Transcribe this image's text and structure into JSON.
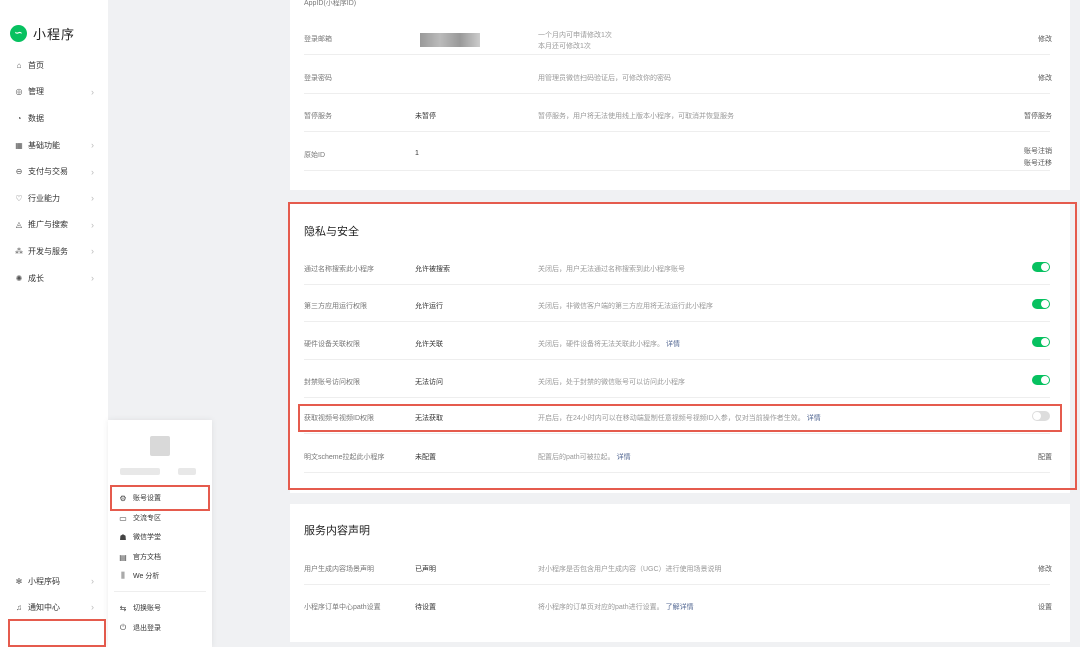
{
  "sidebar": {
    "brand": "小程序",
    "items": [
      {
        "icon": "home-icon",
        "glyph": "⌂",
        "label": "首页",
        "has_children": false
      },
      {
        "icon": "manage-icon",
        "glyph": "◎",
        "label": "管理",
        "has_children": true
      },
      {
        "icon": "data-icon",
        "glyph": "◔",
        "label": "数据",
        "has_children": false
      },
      {
        "icon": "basic-function-icon",
        "glyph": "▦",
        "label": "基础功能",
        "has_children": true
      },
      {
        "icon": "payment-icon",
        "glyph": "⊖",
        "label": "支付与交易",
        "has_children": true
      },
      {
        "icon": "industry-icon",
        "glyph": "♡",
        "label": "行业能力",
        "has_children": true
      },
      {
        "icon": "promotion-icon",
        "glyph": "◬",
        "label": "推广与搜索",
        "has_children": true
      },
      {
        "icon": "dev-service-icon",
        "glyph": "⁂",
        "label": "开发与服务",
        "has_children": true
      },
      {
        "icon": "growth-icon",
        "glyph": "✺",
        "label": "成长",
        "has_children": true
      }
    ],
    "footer": [
      {
        "icon": "miniprogram-code-icon",
        "glyph": "✻",
        "label": "小程序码"
      },
      {
        "icon": "bell-icon",
        "glyph": "♫",
        "label": "通知中心"
      }
    ]
  },
  "popup": {
    "items": [
      {
        "icon": "gear-icon",
        "glyph": "⚙",
        "label": "账号设置"
      },
      {
        "icon": "chat-icon",
        "glyph": "▭",
        "label": "交流专区"
      },
      {
        "icon": "graduation-icon",
        "glyph": "☗",
        "label": "微信学堂"
      },
      {
        "icon": "doc-icon",
        "glyph": "▤",
        "label": "官方文档"
      },
      {
        "icon": "analysis-icon",
        "glyph": "⫼",
        "label": "We 分析"
      },
      {
        "icon": "switch-icon",
        "glyph": "⇆",
        "label": "切换账号"
      },
      {
        "icon": "logout-icon",
        "glyph": "⏻",
        "label": "退出登录"
      }
    ]
  },
  "basic_info": {
    "rows": [
      {
        "key": "AppID(小程序ID)",
        "value": "",
        "desc": "",
        "action": ""
      },
      {
        "key": "登录邮箱",
        "value": "",
        "desc": "一个月内可申请修改1次\n本月还可修改1次",
        "action": "修改"
      },
      {
        "key": "登录密码",
        "value": "",
        "desc": "用管理员微信扫码验证后，可修改你的密码",
        "action": "修改"
      },
      {
        "key": "暂停服务",
        "value": "未暂停",
        "desc": "暂停服务，用户将无法使用线上版本小程序，可取消并恢复服务",
        "action": "暂停服务"
      },
      {
        "key": "原始ID",
        "value": "1",
        "desc": "",
        "action": "账号注销\n账号迁移"
      }
    ]
  },
  "privacy": {
    "title": "隐私与安全",
    "rows": [
      {
        "key": "通过名称搜索此小程序",
        "value": "允许被搜索",
        "desc": "关闭后，用户无法通过名称搜索到此小程序账号",
        "link": "",
        "enabled": true
      },
      {
        "key": "第三方应用运行权限",
        "value": "允许运行",
        "desc": "关闭后，非微信客户端的第三方应用将无法运行此小程序",
        "link": "",
        "enabled": true
      },
      {
        "key": "硬件设备关联权限",
        "value": "允许关联",
        "desc": "关闭后，硬件设备将无法关联此小程序。",
        "link": "详情",
        "enabled": true
      },
      {
        "key": "封禁账号访问权限",
        "value": "无法访问",
        "desc": "关闭后，处于封禁的微信账号可以访问此小程序",
        "link": "",
        "enabled": true
      },
      {
        "key": "获取视频号视频ID权限",
        "value": "无法获取",
        "desc": "开启后，在24小时内可以在移动端复制任意视频号视频ID入参，仅对当前操作者生效。",
        "link": "详情",
        "enabled": false
      },
      {
        "key": "明文scheme拉起此小程序",
        "value": "未配置",
        "desc": "配置后的path可被拉起。",
        "link": "详情",
        "action": "配置"
      }
    ]
  },
  "service": {
    "title": "服务内容声明",
    "rows": [
      {
        "key": "用户生成内容场景声明",
        "value": "已声明",
        "desc": "对小程序是否包含用户生成内容（UGC）进行使用场景说明",
        "link": "",
        "action": "修改"
      },
      {
        "key": "小程序订单中心path设置",
        "value": "待设置",
        "desc": "将小程序的订单页对应的path进行设置。",
        "link": "了解详情",
        "action": "设置"
      }
    ]
  },
  "colors": {
    "accent": "#07c160",
    "highlight": "#e55b4d",
    "link": "#576b95"
  }
}
